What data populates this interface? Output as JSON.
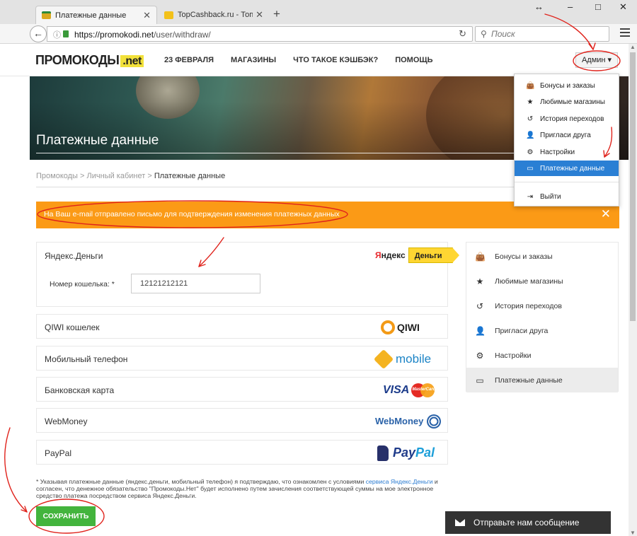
{
  "browser": {
    "tabs": [
      {
        "title": "Платежные данные",
        "favicon_color": "#d9a81f"
      },
      {
        "title": "TopCashback.ru - Топ лу...",
        "favicon_color": "#f3c11a"
      }
    ],
    "new_tab_symbol": "+",
    "url_host": "https://promokodi.net",
    "url_path": "/user/withdraw/",
    "search_placeholder": "Поиск",
    "window_controls": {
      "resize": "↔",
      "minimize": "–",
      "maximize": "□",
      "close": "✕"
    }
  },
  "site": {
    "logo_main": "ПРОМОКОДЫ",
    "logo_net": ".net",
    "nav": [
      "23 ФЕВРАЛЯ",
      "МАГАЗИНЫ",
      "ЧТО ТАКОЕ КЭШБЭК?",
      "ПОМОЩЬ"
    ],
    "admin_label": "Админ ▾",
    "accent_color": "#fb9a16",
    "brand_yellow": "#f2e13a"
  },
  "hero": {
    "title": "Платежные данные"
  },
  "breadcrumb": {
    "items": [
      "Промокоды",
      "Личный кабинет"
    ],
    "separator": ">",
    "current": "Платежные данные"
  },
  "alert": {
    "message": "На Ваш e-mail отправлено письмо для подтверждения изменения платежных данных",
    "close": "✕"
  },
  "payments": {
    "yandex": {
      "label": "Яндекс.Деньги",
      "logo_ya_red": "Я",
      "logo_ya": "ндекс",
      "logo_money": "Деньги",
      "wallet_label": "Номер кошелька: *",
      "wallet_value": "12121212121"
    },
    "rows": [
      {
        "label": "QIWI кошелек",
        "logo": "QIWI",
        "icon": "qiwi-icon"
      },
      {
        "label": "Мобильный телефон",
        "logo": "mobile",
        "icon": "mobile-icon"
      },
      {
        "label": "Банковская карта",
        "logo": "VISA",
        "icon": "mastercard-icon"
      },
      {
        "label": "WebMoney",
        "logo": "WebMoney",
        "icon": "webmoney-globe-icon"
      },
      {
        "label": "PayPal",
        "logo_pay": "Pay",
        "logo_pal": "Pal",
        "icon": "paypal-icon"
      }
    ],
    "mastercard_text": "MasterCard"
  },
  "footnote": {
    "prefix": "* Указывая платежные данные (яндекс.деньги, мобильный телефон) я подтверждаю, что ознакомлен с условиями ",
    "link": "сервиса Яндекс.Деньги",
    "suffix": " и согласен, что денежное обязательство \"Промокоды.Нет\" будет исполнено путем зачисления соответствующей суммы на мое электронное средство платежа посредством сервиса Яндекс.Деньги."
  },
  "save_button": "СОХРАНИТЬ",
  "sidebar": {
    "items": [
      {
        "label": "Бонусы и заказы",
        "icon": "bag-icon"
      },
      {
        "label": "Любимые магазины",
        "icon": "star-icon"
      },
      {
        "label": "История переходов",
        "icon": "history-icon"
      },
      {
        "label": "Пригласи друга",
        "icon": "add-user-icon"
      },
      {
        "label": "Настройки",
        "icon": "gear-icon"
      },
      {
        "label": "Платежные данные",
        "icon": "card-icon",
        "active": true
      }
    ]
  },
  "admin_menu": {
    "items": [
      {
        "label": "Бонусы и заказы",
        "icon": "bag-icon"
      },
      {
        "label": "Любимые магазины",
        "icon": "star-icon"
      },
      {
        "label": "История переходов",
        "icon": "history-icon"
      },
      {
        "label": "Пригласи друга",
        "icon": "add-user-icon"
      },
      {
        "label": "Настройки",
        "icon": "gear-icon"
      },
      {
        "label": "Платежные данные",
        "icon": "card-icon",
        "active": true
      }
    ],
    "logout": "Выйти"
  },
  "chat": {
    "label": "Отправьте нам сообщение"
  },
  "annotation_color": "#e0231c"
}
